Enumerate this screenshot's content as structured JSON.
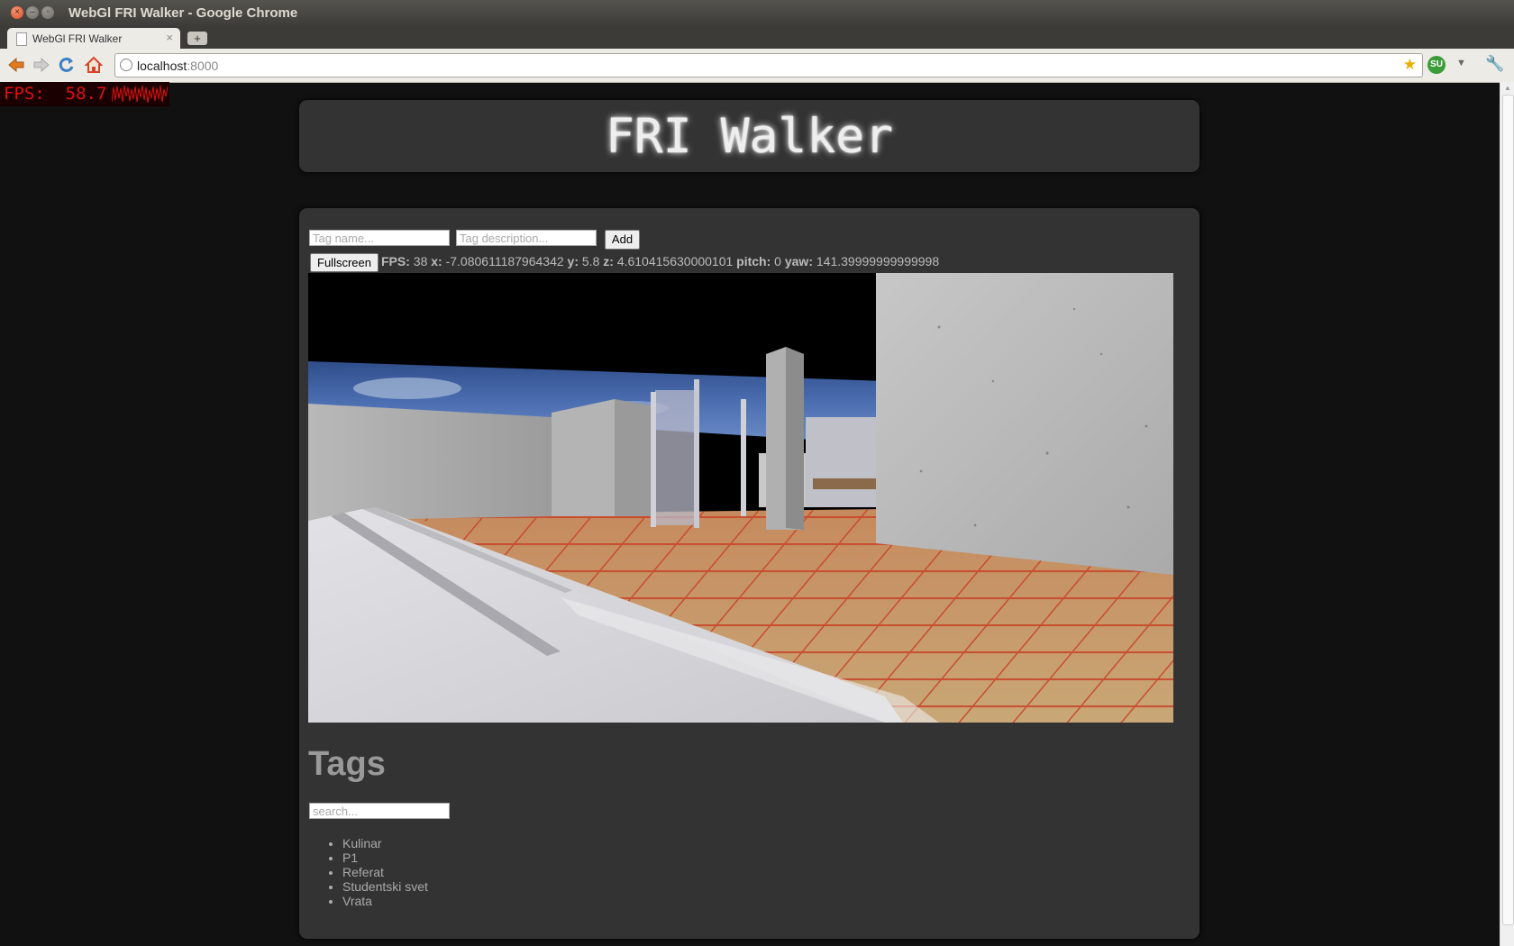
{
  "window": {
    "title": "WebGl FRI Walker - Google Chrome",
    "close_glyph": "×",
    "min_glyph": "–",
    "max_glyph": "▫"
  },
  "tab": {
    "title": "WebGl FRI Walker",
    "close_glyph": "×",
    "new_tab_glyph": "+"
  },
  "toolbar": {
    "url_host": "localhost",
    "url_port": ":8000",
    "icons": [
      "back-arrow-icon",
      "forward-arrow-icon",
      "reload-icon",
      "home-icon",
      "globe-icon",
      "bookmark-star-icon",
      "stumbleupon-icon",
      "dropdown-icon",
      "wrench-icon"
    ],
    "su_label": "SU"
  },
  "fps_overlay": {
    "label": "FPS:",
    "value": "58.7",
    "color": "#e01010"
  },
  "page": {
    "title": "FRI Walker",
    "tag_name_placeholder": "Tag name...",
    "tag_desc_placeholder": "Tag description...",
    "add_label": "Add",
    "fullscreen_label": "Fullscreen",
    "stats": {
      "fps_label": "FPS:",
      "fps": "38",
      "x_label": "x:",
      "x": "-7.080611187964342",
      "y_label": "y:",
      "y": "5.8",
      "z_label": "z:",
      "z": "4.610415630000101",
      "pitch_label": "pitch:",
      "pitch": "0",
      "yaw_label": "yaw:",
      "yaw": "141.39999999999998"
    },
    "tags_heading": "Tags",
    "search_placeholder": "search...",
    "tags": [
      "Kulinar",
      "P1",
      "Referat",
      "Studentski svet",
      "Vrata"
    ]
  },
  "colors": {
    "panel_bg": "#333333",
    "page_bg": "#111111",
    "title_glow": "#ffffff"
  }
}
